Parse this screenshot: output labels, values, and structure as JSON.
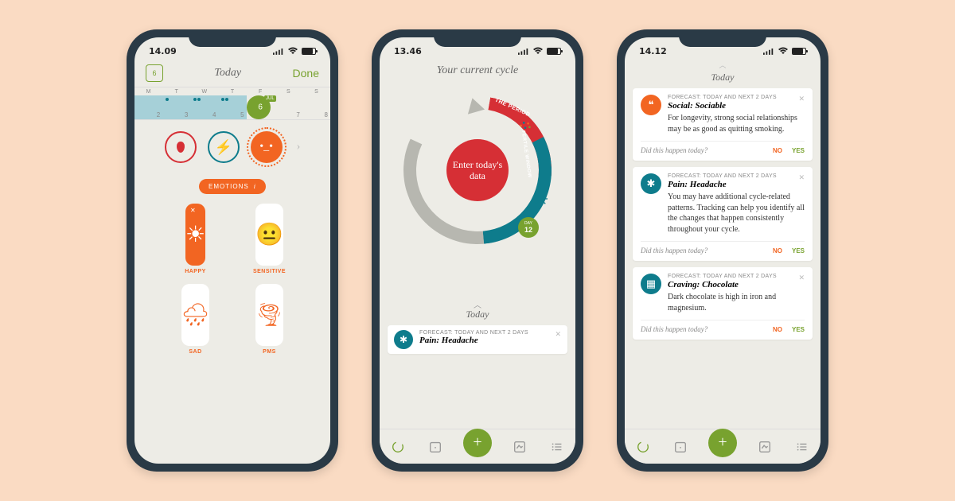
{
  "phone1": {
    "time": "14.09",
    "cal_day": "6",
    "title": "Today",
    "done": "Done",
    "week_days": [
      "M",
      "T",
      "W",
      "T",
      "F",
      "S",
      "S"
    ],
    "week_nums": [
      "2",
      "3",
      "4",
      "5",
      "6",
      "7",
      "8"
    ],
    "jul": "JUL",
    "pill": "EMOTIONS",
    "pill_info": "i",
    "cards": {
      "happy": "HAPPY",
      "sensitive": "SENSITIVE",
      "sad": "SAD",
      "pms": "PMS"
    }
  },
  "phone2": {
    "time": "13.46",
    "title": "Your current cycle",
    "period_label": "THE PERIOD",
    "fertile_label": "FERTILE WINDOW",
    "center": "Enter today's data",
    "day_label": "DAY",
    "day_num": "12",
    "today": "Today",
    "forecast": {
      "sub": "FORECAST: TODAY AND NEXT 2 DAYS",
      "main": "Pain: Headache"
    }
  },
  "phone3": {
    "time": "14.12",
    "today": "Today",
    "cards": [
      {
        "icon": "orange",
        "glyph": "chat",
        "sub": "FORECAST: TODAY AND NEXT 2 DAYS",
        "main": "Social: Sociable",
        "body": "For longevity, strong social relationships may be as good as quitting smoking.",
        "question": "Did this happen today?",
        "no": "NO",
        "yes": "YES"
      },
      {
        "icon": "teal",
        "glyph": "burst",
        "sub": "FORECAST: TODAY AND NEXT 2 DAYS",
        "main": "Pain: Headache",
        "body": "You may have additional cycle-related patterns. Tracking can help you identify all the changes that happen consistently throughout your cycle.",
        "question": "Did this happen today?",
        "no": "NO",
        "yes": "YES"
      },
      {
        "icon": "teal",
        "glyph": "grid",
        "sub": "FORECAST: TODAY AND NEXT 2 DAYS",
        "main": "Craving: Chocolate",
        "body": "Dark chocolate is high in iron and magnesium.",
        "question": "Did this happen today?",
        "no": "NO",
        "yes": "YES"
      }
    ]
  }
}
